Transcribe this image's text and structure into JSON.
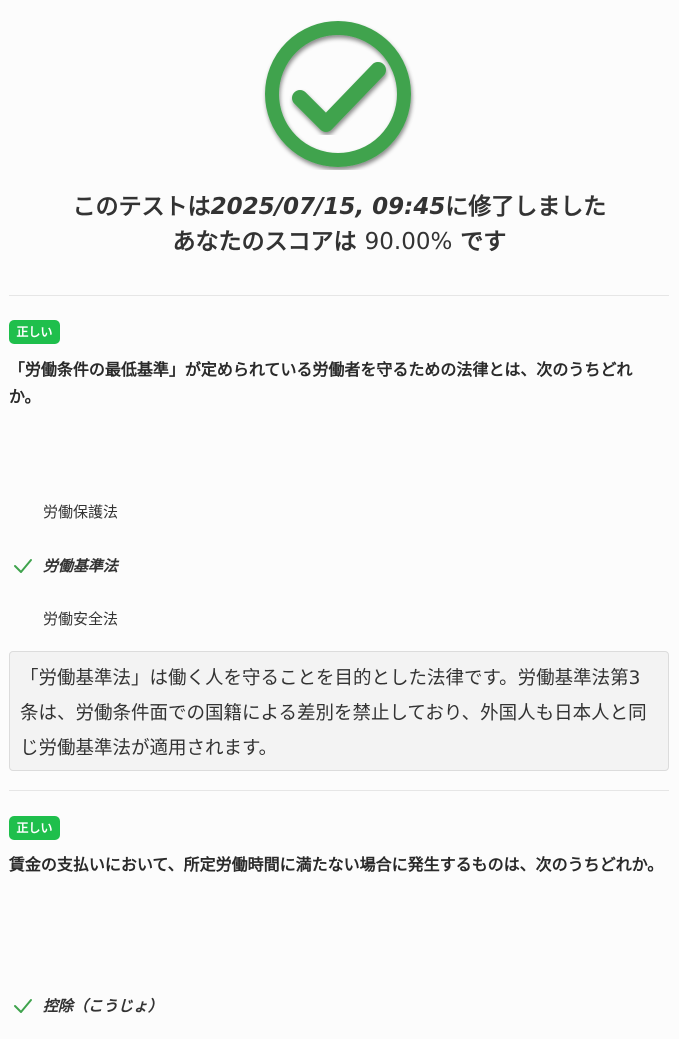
{
  "result": {
    "line1_prefix": "このテストは",
    "line1_date": "2025/07/15, 09:45",
    "line1_suffix": "に修了しました",
    "line2_prefix": "あなたのスコアは ",
    "line2_score": "90.00%",
    "line2_suffix": " です",
    "icon": "check-circle-icon",
    "icon_color": "#3fa34d"
  },
  "questions": [
    {
      "status": "正しい",
      "text": "「労働条件の最低基準」が定められている労働者を守るための法律とは、次のうちどれか。",
      "options": [
        "労働保護法",
        "労働基準法",
        "労働安全法"
      ],
      "selected_index": 1,
      "explanation": "「労働基準法」は働く人を守ることを目的とした法律です。労働基準法第3条は、労働条件面での国籍による差別を禁止しており、外国人も日本人と同じ労働基準法が適用されます。"
    },
    {
      "status": "正しい",
      "text": "賃金の支払いにおいて、所定労働時間に満たない場合に発生するものは、次のうちどれか。",
      "options": [
        "控除（こうじょ）"
      ],
      "selected_index": 0
    }
  ],
  "colors": {
    "badge": "#1fbf4c",
    "check": "#3fa34d",
    "text": "#333333"
  }
}
